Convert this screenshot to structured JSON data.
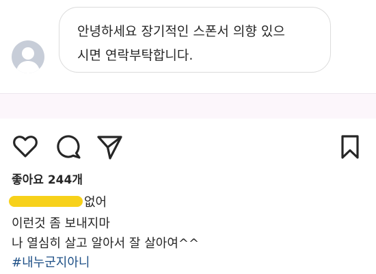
{
  "comment": {
    "text_line1": "안녕하세요 장기적인 스폰서 의향 있으",
    "text_line2": "시면 연락부탁합니다."
  },
  "post": {
    "likes_text": "좋아요 244개",
    "caption": {
      "line1_suffix": "없어",
      "line2": "이런것 좀 보내지마",
      "line3": "나 열심히 살고 알아서 잘 살아여^^",
      "hashtag": "#내누군지아니"
    }
  },
  "icons": {
    "like": "heart-icon",
    "comment": "comment-bubble-icon",
    "share": "paper-plane-icon",
    "save": "bookmark-icon"
  },
  "colors": {
    "redaction_marker": "#f7d11a",
    "hashtag": "#1d4f86",
    "avatar_placeholder": "#c7cdd8"
  }
}
